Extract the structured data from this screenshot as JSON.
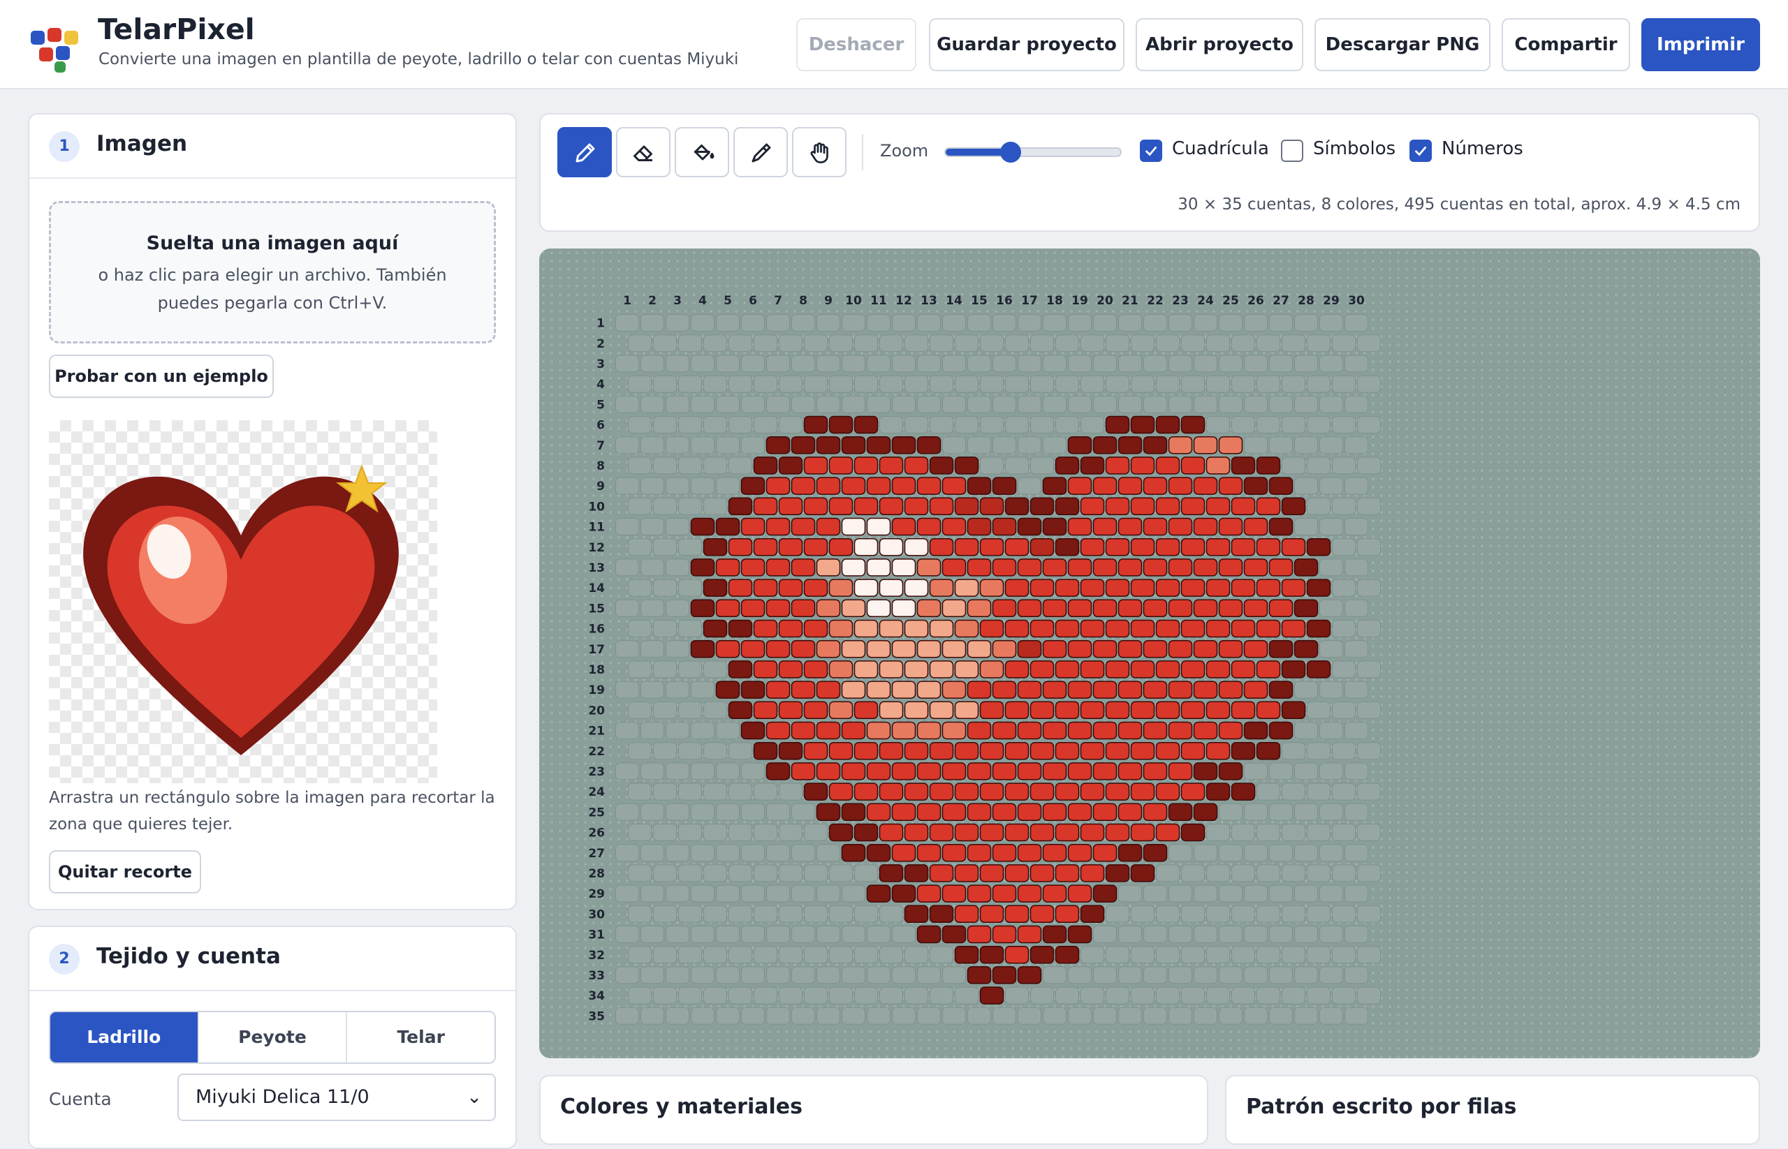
{
  "app": {
    "title": "TelarPixel",
    "subtitle": "Convierte una imagen en plantilla de peyote, ladrillo o telar con cuentas Miyuki"
  },
  "toolbar": {
    "undo": "Deshacer",
    "save": "Guardar proyecto",
    "open": "Abrir proyecto",
    "download": "Descargar PNG",
    "share": "Compartir",
    "print": "Imprimir"
  },
  "image_panel": {
    "step": "1",
    "title": "Imagen",
    "drop_title": "Suelta una imagen aquí",
    "drop_text": "o haz clic para elegir un archivo. También puedes pegarla con Ctrl+V.",
    "example_button": "Probar con un ejemplo",
    "crop_hint": "Arrastra un rectángulo sobre la imagen para recortar la zona que quieres tejer.",
    "remove_crop_button": "Quitar recorte"
  },
  "weave_panel": {
    "step": "2",
    "title": "Tejido y cuenta",
    "stitches": [
      "Ladrillo",
      "Peyote",
      "Telar"
    ],
    "active_stitch": "Ladrillo",
    "bead_label": "Cuenta",
    "bead_value": "Miyuki Delica 11/0"
  },
  "editor": {
    "tools": [
      "pencil-icon",
      "eraser-icon",
      "fill-bucket-icon",
      "eyedropper-icon",
      "hand-icon"
    ],
    "active_tool": "pencil-icon",
    "zoom_label": "Zoom",
    "zoom_level": 0.37,
    "checkboxes": [
      {
        "label": "Cuadrícula",
        "checked": true
      },
      {
        "label": "Símbolos",
        "checked": false
      },
      {
        "label": "Números",
        "checked": true
      }
    ],
    "info": "30 × 35 cuentas, 8 colores, 495 cuentas en total, aprox. 4.9 × 4.5 cm"
  },
  "pattern": {
    "columns": [
      "1",
      "2",
      "3",
      "4",
      "5",
      "6",
      "7",
      "8",
      "9",
      "10",
      "11",
      "12",
      "13",
      "14",
      "15",
      "16",
      "17",
      "18",
      "19",
      "20",
      "21",
      "22",
      "23",
      "24",
      "25",
      "26",
      "27",
      "28",
      "29",
      "30"
    ],
    "rows": [
      "1",
      "2",
      "3",
      "4",
      "5",
      "6",
      "7",
      "8",
      "9",
      "10",
      "11",
      "12",
      "13",
      "14",
      "15",
      "16",
      "17",
      "18",
      "19",
      "20",
      "21",
      "22",
      "23",
      "24",
      "25",
      "26",
      "27",
      "28",
      "29",
      "30",
      "31",
      "32",
      "33",
      "34",
      "35"
    ],
    "colors": {
      "D": "#7a1812",
      "R": "#d8372a",
      "M": "#b82a1e",
      "S": "#e77a5e",
      "P": "#f2a88a",
      "W": "#fdf3ef",
      "E": "#96a6a2"
    },
    "grid": [
      "..............................",
      "..............................",
      "..............................",
      "..............................",
      "..............................",
      ".......DDD.........DDDD.......",
      "......DDDDDDD.....DDDDSSS.....",
      ".....DDRRRRRDD...DDRRRRSDD....",
      ".....DRRRRRRRRDD.DRRRRRRRDD...",
      "....DRRRRRRRRMMDDDRRRRRRRRD...",
      "...DDRRRRWWRRRMMDDRRRRRRRRD...",
      "...DRRRRRWWWRRRRMDRRRRRRRRRD..",
      "...DRRRRPWWWSRRRRRRRRRRRRRRD..",
      "...DRRRRSWWWSPSRRRRRRRRRRRRD..",
      "...DRRRRSPWWSPSRRRRRRRRRRRRD..",
      "...DDRRRSPPPPSRRRRRRRRRRRRRD..",
      "...DRRRRSPPPPPPSMRRRRRRRRRDD..",
      "....DRRRSPPPPPSRRRRRRRRRRRDD..",
      "....DDRRRPPPPSRRRRRRRRRRRRD...",
      "....DRRRSRPPPPRRRRRRRRRRRRD...",
      ".....DRRRRSSSSRRRRRRRRRRRDD...",
      ".....DDRRRRRRRRRRRRRRRRRDD....",
      "......DRRRRRRRRRRRRRRRRDD.....",
      ".......DRRRRRRRRRRRRRRRDD.....",
      "........DDRRRRRRRRRRRRDD......",
      "........DDRRRRRRRRRRRRD.......",
      ".........DDRRRRRRRRRDD........",
      "..........DDRRRRRRRDD.........",
      "..........DDRRRRRRRD..........",
      "...........DDRRRRRD...........",
      "............DDRRRDD...........",
      ".............DDRDD............",
      "..............DDD.............",
      "..............D...............",
      ".............................."
    ]
  },
  "bottom": {
    "colors_title": "Colores y materiales",
    "pattern_title": "Patrón escrito por filas"
  }
}
